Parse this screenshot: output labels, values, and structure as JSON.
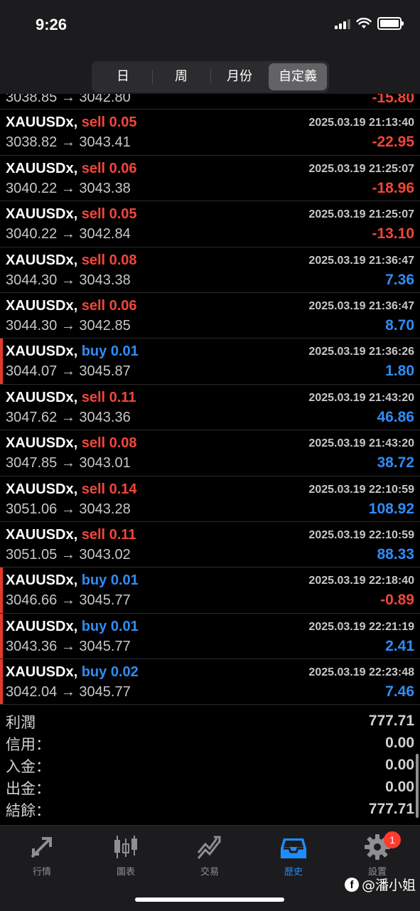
{
  "status": {
    "time": "9:26"
  },
  "tabs_period": [
    {
      "label": "日"
    },
    {
      "label": "周"
    },
    {
      "label": "月份"
    },
    {
      "label": "自定義"
    }
  ],
  "partial_row": {
    "prices": "3038.85 → 3042.80",
    "profit": "-15.80"
  },
  "trades": [
    {
      "symbol": "XAUUSDx,",
      "side": "sell 0.05",
      "time": "2025.03.19 21:13:40",
      "prices": "3038.82 → 3043.41",
      "profit": "-22.95"
    },
    {
      "symbol": "XAUUSDx,",
      "side": "sell 0.06",
      "time": "2025.03.19 21:25:07",
      "prices": "3040.22 → 3043.38",
      "profit": "-18.96"
    },
    {
      "symbol": "XAUUSDx,",
      "side": "sell 0.05",
      "time": "2025.03.19 21:25:07",
      "prices": "3040.22 → 3042.84",
      "profit": "-13.10"
    },
    {
      "symbol": "XAUUSDx,",
      "side": "sell 0.08",
      "time": "2025.03.19 21:36:47",
      "prices": "3044.30 → 3043.38",
      "profit": "7.36"
    },
    {
      "symbol": "XAUUSDx,",
      "side": "sell 0.06",
      "time": "2025.03.19 21:36:47",
      "prices": "3044.30 → 3042.85",
      "profit": "8.70"
    },
    {
      "symbol": "XAUUSDx,",
      "side": "buy 0.01",
      "time": "2025.03.19 21:36:26",
      "prices": "3044.07 → 3045.87",
      "profit": "1.80"
    },
    {
      "symbol": "XAUUSDx,",
      "side": "sell 0.11",
      "time": "2025.03.19 21:43:20",
      "prices": "3047.62 → 3043.36",
      "profit": "46.86"
    },
    {
      "symbol": "XAUUSDx,",
      "side": "sell 0.08",
      "time": "2025.03.19 21:43:20",
      "prices": "3047.85 → 3043.01",
      "profit": "38.72"
    },
    {
      "symbol": "XAUUSDx,",
      "side": "sell 0.14",
      "time": "2025.03.19 22:10:59",
      "prices": "3051.06 → 3043.28",
      "profit": "108.92"
    },
    {
      "symbol": "XAUUSDx,",
      "side": "sell 0.11",
      "time": "2025.03.19 22:10:59",
      "prices": "3051.05 → 3043.02",
      "profit": "88.33"
    },
    {
      "symbol": "XAUUSDx,",
      "side": "buy 0.01",
      "time": "2025.03.19 22:18:40",
      "prices": "3046.66 → 3045.77",
      "profit": "-0.89"
    },
    {
      "symbol": "XAUUSDx,",
      "side": "buy 0.01",
      "time": "2025.03.19 22:21:19",
      "prices": "3043.36 → 3045.77",
      "profit": "2.41"
    },
    {
      "symbol": "XAUUSDx,",
      "side": "buy 0.02",
      "time": "2025.03.19 22:23:48",
      "prices": "3042.04 → 3045.77",
      "profit": "7.46"
    }
  ],
  "summary": [
    {
      "label": "利潤",
      "value": "777.71"
    },
    {
      "label": "信用：",
      "value": "0.00"
    },
    {
      "label": "入金：",
      "value": "0.00"
    },
    {
      "label": "出金：",
      "value": "0.00"
    },
    {
      "label": "結餘：",
      "value": "777.71"
    }
  ],
  "tabbar": [
    {
      "label": "行情",
      "icon": "quotes-arrows-icon"
    },
    {
      "label": "圖表",
      "icon": "candlestick-chart-icon"
    },
    {
      "label": "交易",
      "icon": "trade-trend-icon"
    },
    {
      "label": "歷史",
      "icon": "history-tray-icon"
    },
    {
      "label": "設置",
      "icon": "gear-icon",
      "badge": "1"
    }
  ],
  "watermark": {
    "logo": "f",
    "text": "@潘小姐"
  },
  "colors": {
    "sell": "#f2463b",
    "buy": "#2f8df5",
    "active_tab": "#1e8cff",
    "buy_marker": "#e5382c"
  }
}
